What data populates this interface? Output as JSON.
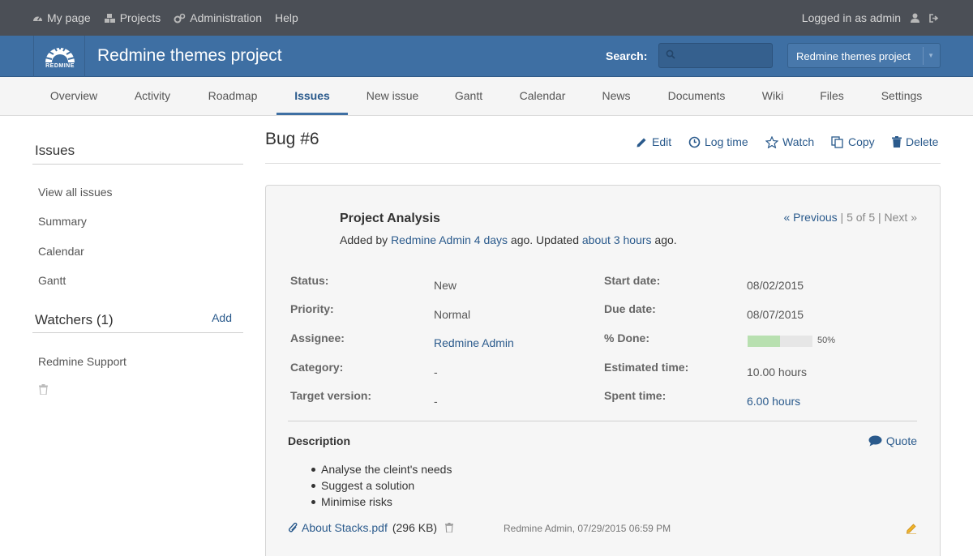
{
  "top_menu": {
    "items": [
      {
        "label": "My page",
        "icon": "dashboard-icon"
      },
      {
        "label": "Projects",
        "icon": "cubes-icon"
      },
      {
        "label": "Administration",
        "icon": "gears-icon"
      },
      {
        "label": "Help",
        "icon": ""
      }
    ],
    "logged_in_as": "Logged in as admin",
    "user_icon": "user-icon",
    "logout_icon": "sign-out-icon"
  },
  "header": {
    "logo_text": "REDMINE",
    "project_title": "Redmine themes project",
    "search_label": "Search:",
    "search_value": "",
    "project_jump": "Redmine themes project"
  },
  "main_menu": {
    "tabs": [
      "Overview",
      "Activity",
      "Roadmap",
      "Issues",
      "New issue",
      "Gantt",
      "Calendar",
      "News",
      "Documents",
      "Wiki",
      "Files",
      "Settings"
    ],
    "selected": "Issues"
  },
  "sidebar": {
    "issues_heading": "Issues",
    "links": [
      "View all issues",
      "Summary",
      "Calendar",
      "Gantt"
    ],
    "watchers_heading": "Watchers (1)",
    "watchers_add": "Add",
    "watchers": [
      "Redmine Support"
    ]
  },
  "issue": {
    "title": "Bug #6",
    "actions": {
      "edit": "Edit",
      "log_time": "Log time",
      "watch": "Watch",
      "copy": "Copy",
      "delete": "Delete"
    },
    "subject": "Project Analysis",
    "added_by_prefix": "Added by",
    "author": "Redmine Admin",
    "created_ago": "4 days",
    "updated_text": "ago. Updated",
    "updated_ago": "about 3 hours",
    "ago_suffix": "ago.",
    "nav": {
      "previous": "« Previous",
      "position": "5 of 5",
      "next": "Next »"
    },
    "attributes_left": [
      {
        "label": "Status:",
        "value": "New",
        "link": false
      },
      {
        "label": "Priority:",
        "value": "Normal",
        "link": false
      },
      {
        "label": "Assignee:",
        "value": "Redmine Admin",
        "link": true
      },
      {
        "label": "Category:",
        "value": "-",
        "link": false
      },
      {
        "label": "Target version:",
        "value": "-",
        "link": false
      }
    ],
    "attributes_right": [
      {
        "label": "Start date:",
        "value": "08/02/2015"
      },
      {
        "label": "Due date:",
        "value": "08/07/2015"
      },
      {
        "label": "% Done:",
        "value": "50%",
        "done_ratio": 0.5
      },
      {
        "label": "Estimated time:",
        "value": "10.00 hours"
      },
      {
        "label": "Spent time:",
        "value": "6.00 hours"
      }
    ],
    "description_heading": "Description",
    "quote_label": "Quote",
    "description_items": [
      "Analyse the cleint's needs",
      "Suggest a solution",
      "Minimise risks"
    ],
    "attachment": {
      "filename": "About Stacks.pdf",
      "size": "(296 KB)",
      "meta": "Redmine Admin, 07/29/2015 06:59 PM"
    }
  },
  "colors": {
    "top_bar": "#4b4f56",
    "header": "#3e6fa3",
    "link": "#2a5a8c",
    "progress_fill": "#b8e0b0"
  }
}
